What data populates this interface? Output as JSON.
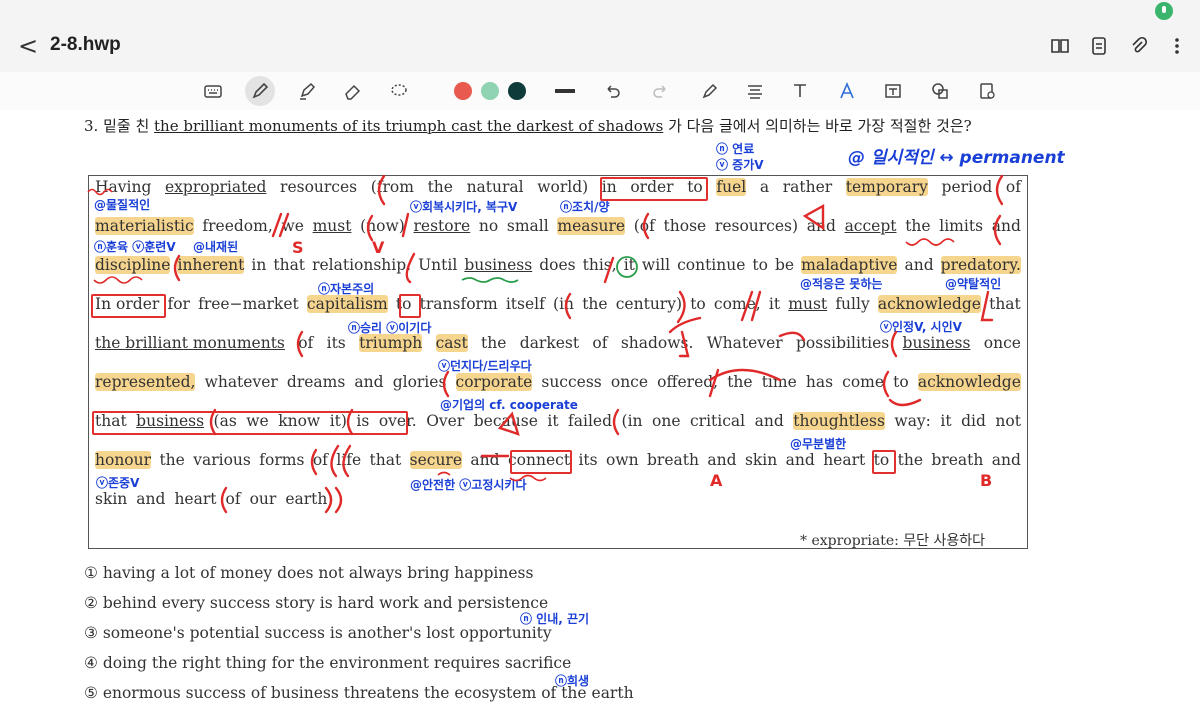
{
  "header": {
    "title": "2-8.hwp",
    "back_label": "<"
  },
  "toolbar": {
    "colors": [
      "#e85a4f",
      "#8fd3b3",
      "#0f3b3a"
    ]
  },
  "question": {
    "prefix": "3. 밑줄 친",
    "underlined": "the brilliant monuments of its triumph cast the darkest of shadows",
    "suffix": "가 다음 글에서 의미하는 바로 가장 적절한 것은?"
  },
  "passage": {
    "lines": [
      [
        "Having",
        "expropriated",
        "resources",
        "(from",
        "the",
        "natural",
        "world)",
        "in",
        "order",
        "to",
        "fuel",
        "a",
        "rather",
        "temporary",
        "period",
        "of"
      ],
      [
        "materialistic",
        "freedom,",
        "we",
        "must",
        "(now)",
        "restore",
        "no",
        "small",
        "measure",
        "(of",
        "those",
        "resources)",
        "and",
        "accept",
        "the",
        "limits",
        "and"
      ],
      [
        "discipline",
        "inherent",
        "in",
        "that",
        "relationship.",
        "Until",
        "business",
        "does",
        "this,",
        "it",
        "will",
        "continue",
        "to",
        "be",
        "maladaptive",
        "and",
        "predatory."
      ],
      [
        "In order",
        "for",
        "free−market",
        "capitalism",
        "to",
        "transform",
        "itself",
        "(in",
        "the",
        "century)",
        "to",
        "come,",
        "it",
        "must",
        "fully",
        "acknowledge",
        "that"
      ],
      [
        "the brilliant monuments",
        "of",
        "its",
        "triumph",
        "cast",
        "the",
        "darkest",
        "of",
        "shadows.",
        "Whatever",
        "possibilities",
        "business",
        "once"
      ],
      [
        "represented,",
        "whatever",
        "dreams",
        "and",
        "glories",
        "corporate",
        "success",
        "once",
        "offered,",
        "the",
        "time",
        "has",
        "come",
        "to",
        "acknowledge"
      ],
      [
        "that",
        "business",
        "(as",
        "we",
        "know",
        "it)",
        "is",
        "over.",
        "Over",
        "because",
        "it",
        "failed",
        "(in",
        "one",
        "critical",
        "and",
        "thoughtless",
        "way:",
        "it",
        "did",
        "not"
      ],
      [
        "honour",
        "the",
        "various",
        "forms",
        "of",
        "life",
        "that",
        "secure",
        "and",
        "connect",
        "its",
        "own",
        "breath",
        "and",
        "skin",
        "and",
        "heart",
        "to",
        "the",
        "breath",
        "and"
      ],
      [
        "skin",
        "and",
        "heart",
        "of",
        "our",
        "earth)"
      ]
    ],
    "footnote": "* expropriate: 무단 사용하다"
  },
  "options": [
    "① having a lot of money does not always bring happiness",
    "② behind every success story is hard work and persistence",
    "③ someone's potential success is another's lost opportunity",
    "④ doing the right thing for the environment requires sacrifice",
    "⑤ enormous success of business threatens the ecosystem of the earth"
  ],
  "annotations": {
    "n1": "ⓝ 연료",
    "n2": "ⓥ 증가V",
    "n3": "@ 일시적인 ↔ permanent",
    "n4": "@물질적인",
    "n5": "ⓥ회복시키다, 복구V",
    "n6": "ⓝ조치/양",
    "n7": "ⓝ훈육 ⓥ훈련V",
    "n8": "@내재된",
    "n9": "@적응은 못하는",
    "n10": "@약탈적인",
    "n11": "ⓝ자본주의",
    "n12": "ⓥ인정V, 시인V",
    "n13": "ⓝ승리 ⓥ이기다",
    "n14": "ⓥ던지다/드리우다",
    "n15": "@기업의 cf. cooperate",
    "n16": "@무분별한",
    "n17": "ⓥ존중V",
    "n18": "@안전한 ⓥ고정시키다",
    "n19": "ⓝ 인내, 끈기",
    "n20": "ⓝ희생",
    "s_label": "S",
    "v_label": "V",
    "a_label": "A",
    "b_label": "B"
  }
}
